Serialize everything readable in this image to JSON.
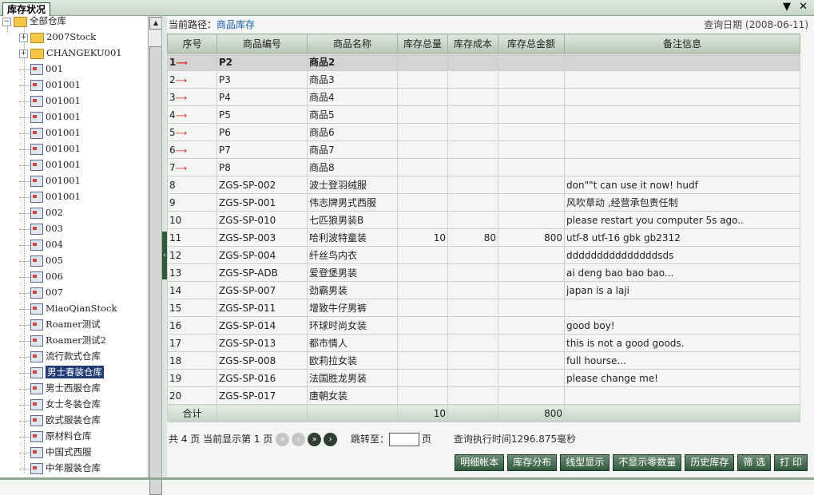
{
  "window": {
    "title": "库存状况",
    "menu_icon": "▼",
    "close_icon": "✕"
  },
  "tree": {
    "root": "全部仓库",
    "nodes": [
      {
        "label": "2007Stock",
        "type": "folder",
        "expanded": false
      },
      {
        "label": "CHANGEKU001",
        "type": "folder",
        "expanded": false
      },
      {
        "label": "001",
        "type": "store"
      },
      {
        "label": "001001",
        "type": "store"
      },
      {
        "label": "001001",
        "type": "store"
      },
      {
        "label": "001001",
        "type": "store"
      },
      {
        "label": "001001",
        "type": "store"
      },
      {
        "label": "001001",
        "type": "store"
      },
      {
        "label": "001001",
        "type": "store"
      },
      {
        "label": "001001",
        "type": "store"
      },
      {
        "label": "001001",
        "type": "store"
      },
      {
        "label": "002",
        "type": "store"
      },
      {
        "label": "003",
        "type": "store"
      },
      {
        "label": "004",
        "type": "store"
      },
      {
        "label": "005",
        "type": "store"
      },
      {
        "label": "006",
        "type": "store"
      },
      {
        "label": "007",
        "type": "store"
      },
      {
        "label": "MiaoQianStock",
        "type": "store"
      },
      {
        "label": "Roamer测试",
        "type": "store"
      },
      {
        "label": "Roamer测试2",
        "type": "store"
      },
      {
        "label": "流行款式仓库",
        "type": "store"
      },
      {
        "label": "男士春装仓库",
        "type": "store",
        "selected": true
      },
      {
        "label": "男士西服仓库",
        "type": "store"
      },
      {
        "label": "女士冬装仓库",
        "type": "store"
      },
      {
        "label": "欧式服装仓库",
        "type": "store"
      },
      {
        "label": "原材料仓库",
        "type": "store"
      },
      {
        "label": "中国式西服",
        "type": "store"
      },
      {
        "label": "中年服装仓库",
        "type": "store"
      }
    ]
  },
  "path": {
    "label": "当前路径：",
    "value": "商品库存"
  },
  "query_date": "查询日期 (2008-06-11)",
  "table": {
    "columns": [
      "序号",
      "商品编号",
      "商品名称",
      "库存总量",
      "库存成本",
      "库存总金额",
      "备注信息"
    ],
    "rows": [
      {
        "no": "1",
        "code": "P2",
        "name": "商品2",
        "qty": "",
        "cost": "",
        "amount": "",
        "note": "",
        "arrow": true,
        "selected": true
      },
      {
        "no": "2",
        "code": "P3",
        "name": "商品3",
        "qty": "",
        "cost": "",
        "amount": "",
        "note": "",
        "arrow": true
      },
      {
        "no": "3",
        "code": "P4",
        "name": "商品4",
        "qty": "",
        "cost": "",
        "amount": "",
        "note": "",
        "arrow": true
      },
      {
        "no": "4",
        "code": "P5",
        "name": "商品5",
        "qty": "",
        "cost": "",
        "amount": "",
        "note": "",
        "arrow": true
      },
      {
        "no": "5",
        "code": "P6",
        "name": "商品6",
        "qty": "",
        "cost": "",
        "amount": "",
        "note": "",
        "arrow": true
      },
      {
        "no": "6",
        "code": "P7",
        "name": "商品7",
        "qty": "",
        "cost": "",
        "amount": "",
        "note": "",
        "arrow": true
      },
      {
        "no": "7",
        "code": "P8",
        "name": "商品8",
        "qty": "",
        "cost": "",
        "amount": "",
        "note": "",
        "arrow": true
      },
      {
        "no": "8",
        "code": "ZGS-SP-002",
        "name": "波士登羽绒服",
        "qty": "",
        "cost": "",
        "amount": "",
        "note": "don\"\"t can use it now! hudf"
      },
      {
        "no": "9",
        "code": "ZGS-SP-001",
        "name": "伟志牌男式西服",
        "qty": "",
        "cost": "",
        "amount": "",
        "note": "风吹草动 ,经营承包责任制"
      },
      {
        "no": "10",
        "code": "ZGS-SP-010",
        "name": "七匹狼男装B",
        "qty": "",
        "cost": "",
        "amount": "",
        "note": "please restart you computer 5s ago.."
      },
      {
        "no": "11",
        "code": "ZGS-SP-003",
        "name": "哈利波特童装",
        "qty": "10",
        "cost": "80",
        "amount": "800",
        "note": "utf-8 utf-16 gbk gb2312"
      },
      {
        "no": "12",
        "code": "ZGS-SP-004",
        "name": "纤丝鸟内衣",
        "qty": "",
        "cost": "",
        "amount": "",
        "note": "dddddddddddddddsds"
      },
      {
        "no": "13",
        "code": "ZGS-SP-ADB",
        "name": "爱登堡男装",
        "qty": "",
        "cost": "",
        "amount": "",
        "note": "ai deng bao bao bao..."
      },
      {
        "no": "14",
        "code": "ZGS-SP-007",
        "name": "劲霸男装",
        "qty": "",
        "cost": "",
        "amount": "",
        "note": "japan is a laji"
      },
      {
        "no": "15",
        "code": "ZGS-SP-011",
        "name": "增致牛仔男裤",
        "qty": "",
        "cost": "",
        "amount": "",
        "note": ""
      },
      {
        "no": "16",
        "code": "ZGS-SP-014",
        "name": "环球时尚女装",
        "qty": "",
        "cost": "",
        "amount": "",
        "note": "good boy!"
      },
      {
        "no": "17",
        "code": "ZGS-SP-013",
        "name": "都市情人",
        "qty": "",
        "cost": "",
        "amount": "",
        "note": "this is not a good goods."
      },
      {
        "no": "18",
        "code": "ZGS-SP-008",
        "name": "欧莉拉女装",
        "qty": "",
        "cost": "",
        "amount": "",
        "note": "full hourse..."
      },
      {
        "no": "19",
        "code": "ZGS-SP-016",
        "name": "法国胜龙男装",
        "qty": "",
        "cost": "",
        "amount": "",
        "note": "please change me!"
      },
      {
        "no": "20",
        "code": "ZGS-SP-017",
        "name": "唐朝女装",
        "qty": "",
        "cost": "",
        "amount": "",
        "note": ""
      }
    ],
    "total": {
      "label": "合计",
      "qty": "10",
      "amount": "800"
    }
  },
  "pager": {
    "summary": "共 4 页 当前显示第 1 页",
    "jump_label": "跳转至：",
    "page_suffix": "页",
    "jump_value": "",
    "exec_time": "查询执行时间1296.875毫秒"
  },
  "actions": [
    "明细帐本",
    "库存分布",
    "线型显示",
    "不显示零数量",
    "历史库存",
    "筛 选",
    "打 印"
  ]
}
